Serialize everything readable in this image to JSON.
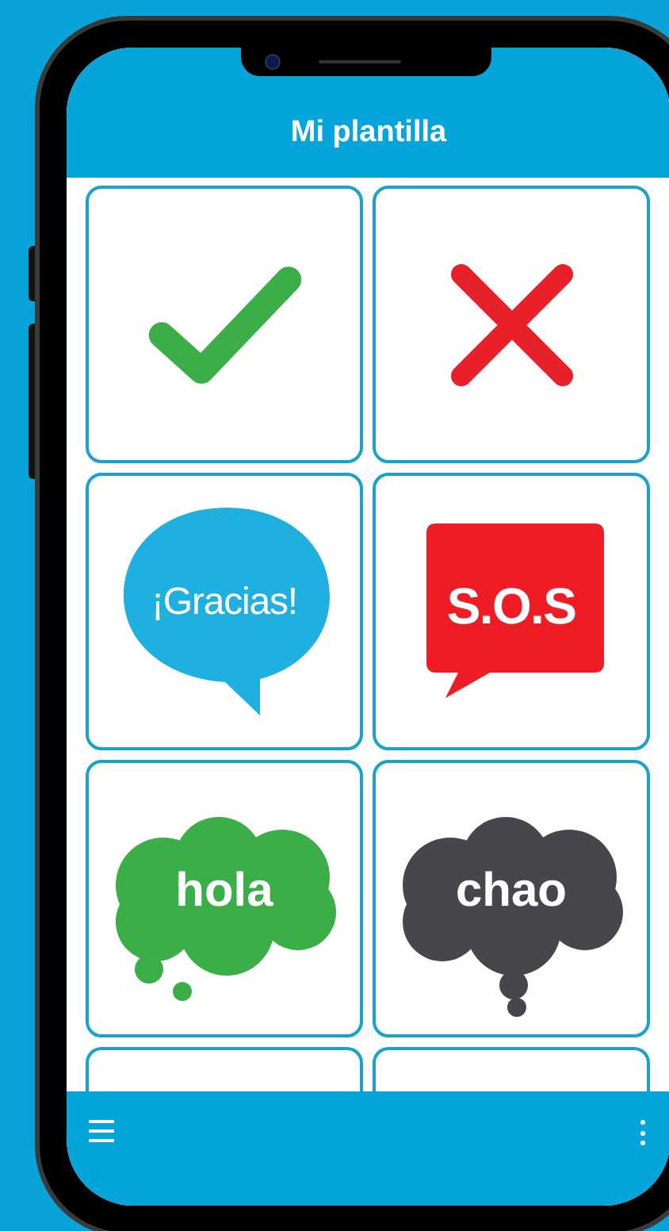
{
  "header": {
    "title": "Mi plantilla"
  },
  "tiles": [
    {
      "kind": "check"
    },
    {
      "kind": "cross"
    },
    {
      "kind": "bubble",
      "text": "¡Gracias!",
      "color": "#1fb0e0"
    },
    {
      "kind": "box",
      "text": "S.O.S",
      "color": "#ee1c25"
    },
    {
      "kind": "cloud",
      "text": "hola",
      "color": "#3bae48"
    },
    {
      "kind": "cloud",
      "text": "chao",
      "color": "#48464c"
    },
    {
      "kind": "empty"
    },
    {
      "kind": "empty"
    }
  ],
  "bottom_bar": {
    "menu": true,
    "more": true
  }
}
